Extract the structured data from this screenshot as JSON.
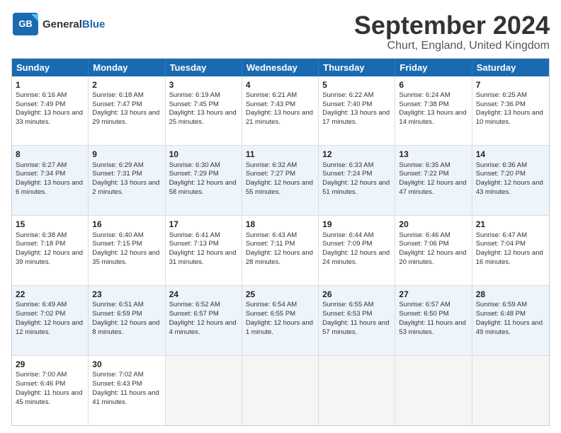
{
  "header": {
    "logo_general": "General",
    "logo_blue": "Blue",
    "month_title": "September 2024",
    "location": "Churt, England, United Kingdom"
  },
  "days": [
    "Sunday",
    "Monday",
    "Tuesday",
    "Wednesday",
    "Thursday",
    "Friday",
    "Saturday"
  ],
  "rows": [
    [
      {
        "day": "1",
        "sunrise": "Sunrise: 6:16 AM",
        "sunset": "Sunset: 7:49 PM",
        "daylight": "Daylight: 13 hours and 33 minutes."
      },
      {
        "day": "2",
        "sunrise": "Sunrise: 6:18 AM",
        "sunset": "Sunset: 7:47 PM",
        "daylight": "Daylight: 13 hours and 29 minutes."
      },
      {
        "day": "3",
        "sunrise": "Sunrise: 6:19 AM",
        "sunset": "Sunset: 7:45 PM",
        "daylight": "Daylight: 13 hours and 25 minutes."
      },
      {
        "day": "4",
        "sunrise": "Sunrise: 6:21 AM",
        "sunset": "Sunset: 7:43 PM",
        "daylight": "Daylight: 13 hours and 21 minutes."
      },
      {
        "day": "5",
        "sunrise": "Sunrise: 6:22 AM",
        "sunset": "Sunset: 7:40 PM",
        "daylight": "Daylight: 13 hours and 17 minutes."
      },
      {
        "day": "6",
        "sunrise": "Sunrise: 6:24 AM",
        "sunset": "Sunset: 7:38 PM",
        "daylight": "Daylight: 13 hours and 14 minutes."
      },
      {
        "day": "7",
        "sunrise": "Sunrise: 6:25 AM",
        "sunset": "Sunset: 7:36 PM",
        "daylight": "Daylight: 13 hours and 10 minutes."
      }
    ],
    [
      {
        "day": "8",
        "sunrise": "Sunrise: 6:27 AM",
        "sunset": "Sunset: 7:34 PM",
        "daylight": "Daylight: 13 hours and 6 minutes."
      },
      {
        "day": "9",
        "sunrise": "Sunrise: 6:29 AM",
        "sunset": "Sunset: 7:31 PM",
        "daylight": "Daylight: 13 hours and 2 minutes."
      },
      {
        "day": "10",
        "sunrise": "Sunrise: 6:30 AM",
        "sunset": "Sunset: 7:29 PM",
        "daylight": "Daylight: 12 hours and 58 minutes."
      },
      {
        "day": "11",
        "sunrise": "Sunrise: 6:32 AM",
        "sunset": "Sunset: 7:27 PM",
        "daylight": "Daylight: 12 hours and 55 minutes."
      },
      {
        "day": "12",
        "sunrise": "Sunrise: 6:33 AM",
        "sunset": "Sunset: 7:24 PM",
        "daylight": "Daylight: 12 hours and 51 minutes."
      },
      {
        "day": "13",
        "sunrise": "Sunrise: 6:35 AM",
        "sunset": "Sunset: 7:22 PM",
        "daylight": "Daylight: 12 hours and 47 minutes."
      },
      {
        "day": "14",
        "sunrise": "Sunrise: 6:36 AM",
        "sunset": "Sunset: 7:20 PM",
        "daylight": "Daylight: 12 hours and 43 minutes."
      }
    ],
    [
      {
        "day": "15",
        "sunrise": "Sunrise: 6:38 AM",
        "sunset": "Sunset: 7:18 PM",
        "daylight": "Daylight: 12 hours and 39 minutes."
      },
      {
        "day": "16",
        "sunrise": "Sunrise: 6:40 AM",
        "sunset": "Sunset: 7:15 PM",
        "daylight": "Daylight: 12 hours and 35 minutes."
      },
      {
        "day": "17",
        "sunrise": "Sunrise: 6:41 AM",
        "sunset": "Sunset: 7:13 PM",
        "daylight": "Daylight: 12 hours and 31 minutes."
      },
      {
        "day": "18",
        "sunrise": "Sunrise: 6:43 AM",
        "sunset": "Sunset: 7:11 PM",
        "daylight": "Daylight: 12 hours and 28 minutes."
      },
      {
        "day": "19",
        "sunrise": "Sunrise: 6:44 AM",
        "sunset": "Sunset: 7:09 PM",
        "daylight": "Daylight: 12 hours and 24 minutes."
      },
      {
        "day": "20",
        "sunrise": "Sunrise: 6:46 AM",
        "sunset": "Sunset: 7:06 PM",
        "daylight": "Daylight: 12 hours and 20 minutes."
      },
      {
        "day": "21",
        "sunrise": "Sunrise: 6:47 AM",
        "sunset": "Sunset: 7:04 PM",
        "daylight": "Daylight: 12 hours and 16 minutes."
      }
    ],
    [
      {
        "day": "22",
        "sunrise": "Sunrise: 6:49 AM",
        "sunset": "Sunset: 7:02 PM",
        "daylight": "Daylight: 12 hours and 12 minutes."
      },
      {
        "day": "23",
        "sunrise": "Sunrise: 6:51 AM",
        "sunset": "Sunset: 6:59 PM",
        "daylight": "Daylight: 12 hours and 8 minutes."
      },
      {
        "day": "24",
        "sunrise": "Sunrise: 6:52 AM",
        "sunset": "Sunset: 6:57 PM",
        "daylight": "Daylight: 12 hours and 4 minutes."
      },
      {
        "day": "25",
        "sunrise": "Sunrise: 6:54 AM",
        "sunset": "Sunset: 6:55 PM",
        "daylight": "Daylight: 12 hours and 1 minute."
      },
      {
        "day": "26",
        "sunrise": "Sunrise: 6:55 AM",
        "sunset": "Sunset: 6:53 PM",
        "daylight": "Daylight: 11 hours and 57 minutes."
      },
      {
        "day": "27",
        "sunrise": "Sunrise: 6:57 AM",
        "sunset": "Sunset: 6:50 PM",
        "daylight": "Daylight: 11 hours and 53 minutes."
      },
      {
        "day": "28",
        "sunrise": "Sunrise: 6:59 AM",
        "sunset": "Sunset: 6:48 PM",
        "daylight": "Daylight: 11 hours and 49 minutes."
      }
    ],
    [
      {
        "day": "29",
        "sunrise": "Sunrise: 7:00 AM",
        "sunset": "Sunset: 6:46 PM",
        "daylight": "Daylight: 11 hours and 45 minutes."
      },
      {
        "day": "30",
        "sunrise": "Sunrise: 7:02 AM",
        "sunset": "Sunset: 6:43 PM",
        "daylight": "Daylight: 11 hours and 41 minutes."
      },
      {
        "day": "",
        "sunrise": "",
        "sunset": "",
        "daylight": ""
      },
      {
        "day": "",
        "sunrise": "",
        "sunset": "",
        "daylight": ""
      },
      {
        "day": "",
        "sunrise": "",
        "sunset": "",
        "daylight": ""
      },
      {
        "day": "",
        "sunrise": "",
        "sunset": "",
        "daylight": ""
      },
      {
        "day": "",
        "sunrise": "",
        "sunset": "",
        "daylight": ""
      }
    ]
  ]
}
